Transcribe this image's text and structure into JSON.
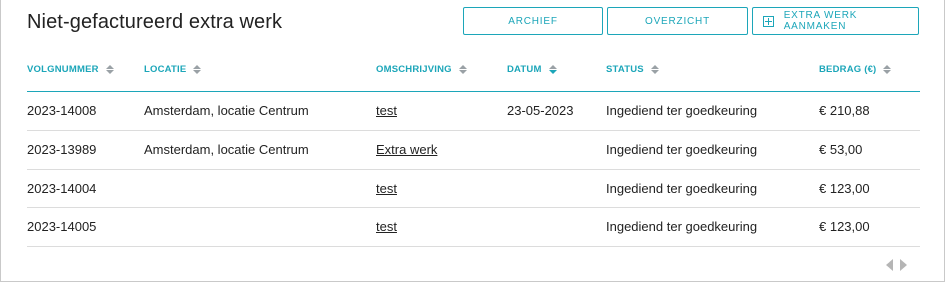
{
  "title": "Niet-gefactureerd extra werk",
  "buttons": {
    "archive": "ARCHIEF",
    "overview": "OVERZICHT",
    "add": "EXTRA WERK AANMAKEN",
    "add_icon": "plus-square-icon"
  },
  "columns": [
    "VOLGNUMMER",
    "LOCATIE",
    "OMSCHRIJVING",
    "DATUM",
    "STATUS",
    "BEDRAG (€)"
  ],
  "sorted_column": "DATUM",
  "rows": [
    {
      "number": "2023-14008",
      "location": "Amsterdam, locatie Centrum",
      "description": "test",
      "date": "23-05-2023",
      "status": "Ingediend ter goedkeuring",
      "amount": "€ 210,88"
    },
    {
      "number": "2023-13989",
      "location": "Amsterdam, locatie Centrum",
      "description": "Extra werk",
      "date": "",
      "status": "Ingediend ter goedkeuring",
      "amount": "€ 53,00"
    },
    {
      "number": "2023-14004",
      "location": "",
      "description": "test",
      "date": "",
      "status": "Ingediend ter goedkeuring",
      "amount": "€ 123,00"
    },
    {
      "number": "2023-14005",
      "location": "",
      "description": "test",
      "date": "",
      "status": "Ingediend ter goedkeuring",
      "amount": "€ 123,00"
    }
  ],
  "colors": {
    "accent": "#1ca6b9",
    "text": "#222222",
    "sort_inactive": "#9aa1a6"
  }
}
